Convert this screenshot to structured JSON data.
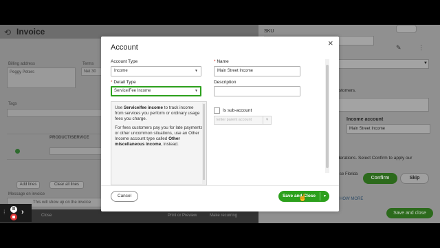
{
  "background": {
    "invoice_title": "Invoice",
    "billing_address_label": "Billing address",
    "customer_name": "Peggy Peters",
    "terms_label": "Terms",
    "terms_value": "Net 30",
    "tags_label": "Tags",
    "product_service_header": "PRODUCT/SERVICE",
    "add_lines_label": "Add lines",
    "clear_all_lines_label": "Clear all lines",
    "message_label": "Message on invoice",
    "message_placeholder": "This will show up on the invoice",
    "bottom_close": "Close",
    "bottom_print": "Print or Preview",
    "bottom_recurring": "Make recurring",
    "sku_label": "SKU",
    "customers_text": "customers.",
    "income_account_label": "Income account",
    "income_account_value": "Main Street Income",
    "considerations_text": "siderations. Select Confirm to apply our",
    "florida_text": "se Florida",
    "confirm_label": "Confirm",
    "skip_label": "Skip",
    "show_more_label": "HOW MORE",
    "save_and_close_label": "Save and close"
  },
  "modal": {
    "title": "Account",
    "account_type_label": "Account Type",
    "account_type_value": "Income",
    "detail_type_label": "Detail Type",
    "detail_type_value": "Service/Fee Income",
    "name_label": "Name",
    "name_value": "Main Street Income",
    "description_label": "Description",
    "description_value": "",
    "is_subaccount_label": "Is sub-account",
    "parent_account_placeholder": "Enter parent account",
    "help_p1_pre": "Use ",
    "help_p1_bold": "Service/fee income",
    "help_p1_post": " to track income from services you perform or ordinary usage fees you charge.",
    "help_p2_pre": "For fees customers pay you for late payments or other uncommon situations, use an Other Income account type called ",
    "help_p2_bold": "Other miscellaneous income",
    "help_p2_post": ", instead.",
    "cancel_label": "Cancel",
    "save_label": "Save and Close",
    "required_marker": "*"
  },
  "colors": {
    "accent_green": "#2ca01c",
    "required_red": "#d52b1e"
  }
}
